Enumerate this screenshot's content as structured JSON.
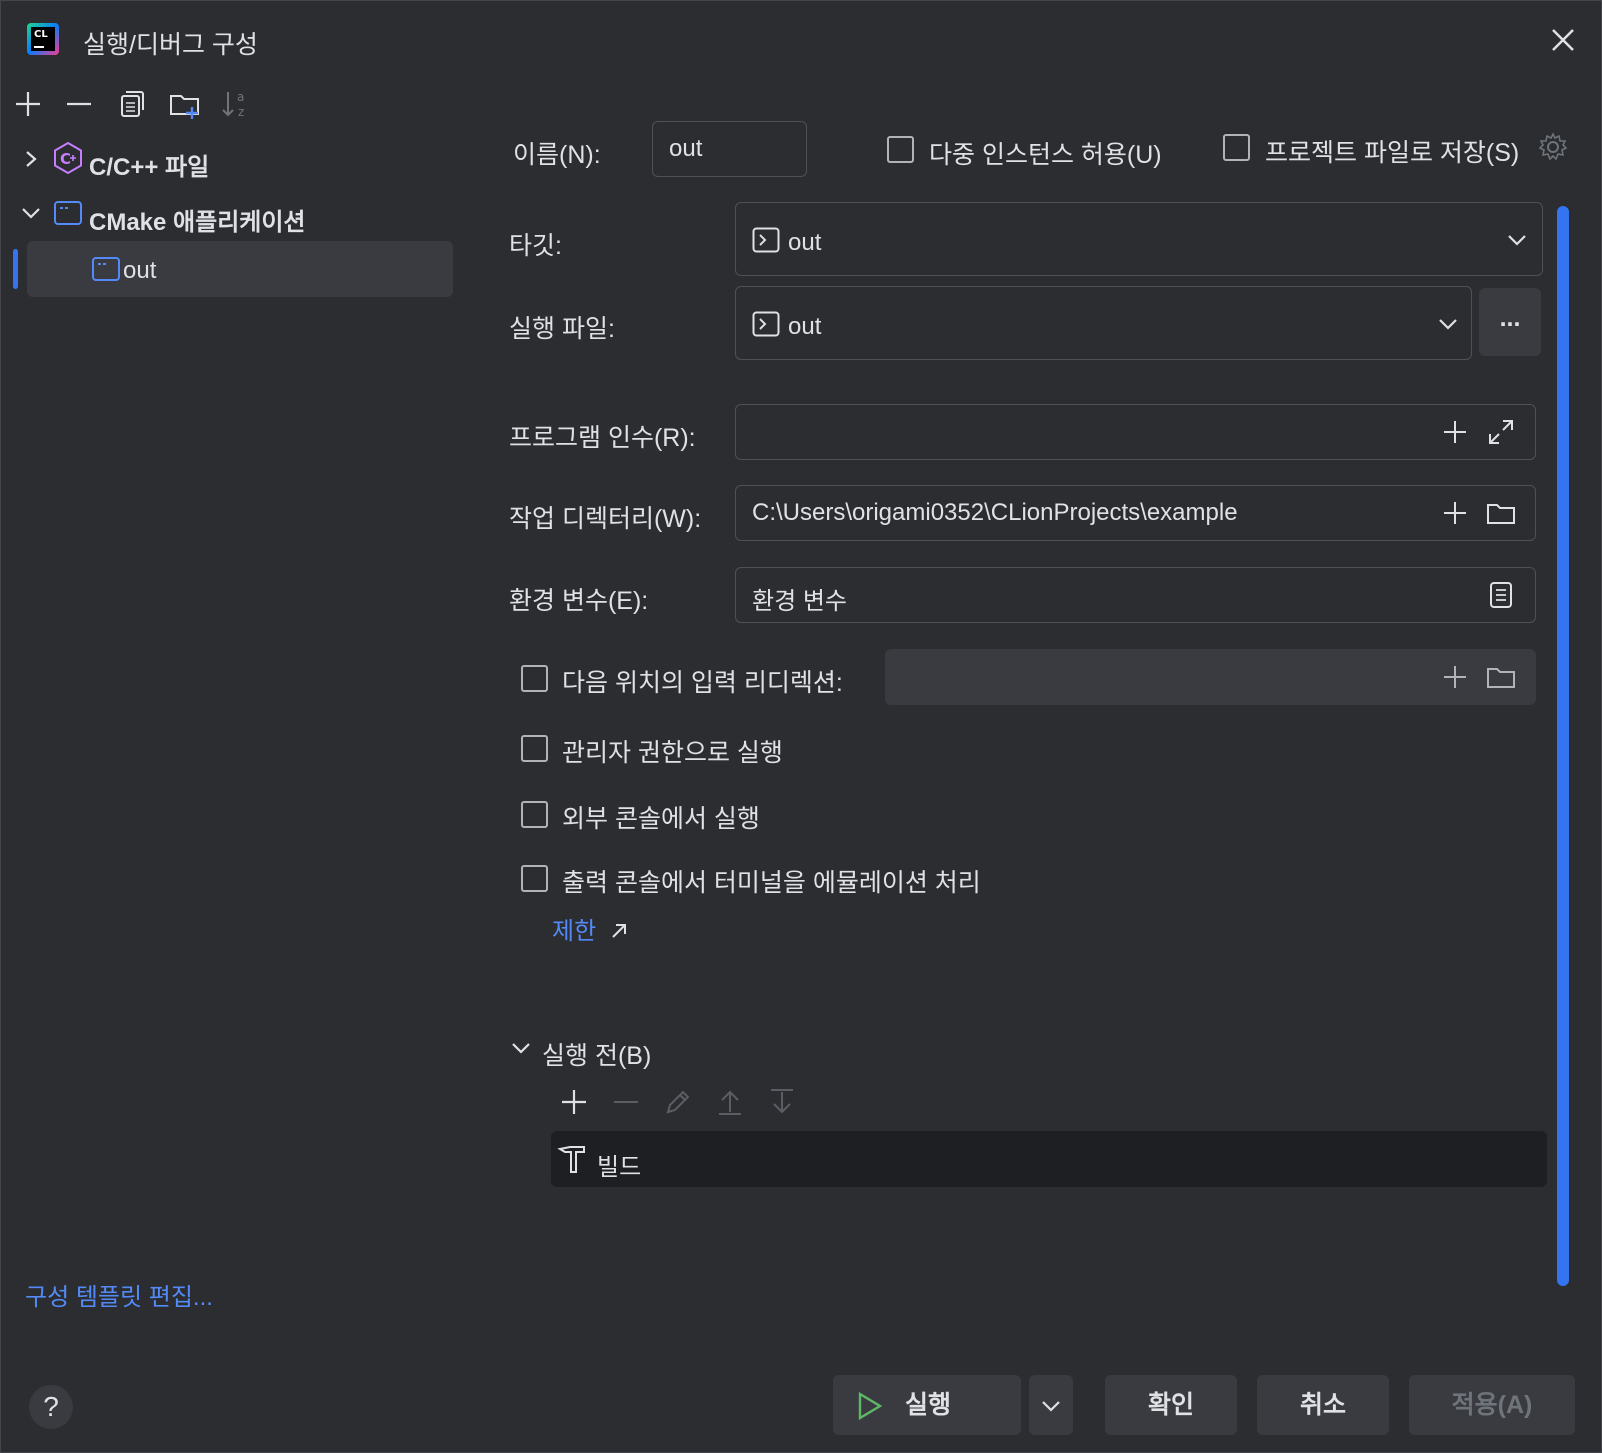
{
  "window": {
    "title": "실행/디버그 구성"
  },
  "left_toolbar": {
    "add": "add-icon",
    "remove": "remove-icon",
    "copy": "copy-icon",
    "folder": "new-folder-icon",
    "sort": "sort-icon"
  },
  "tree": {
    "group1": {
      "label": "C/C++ 파일"
    },
    "group2": {
      "label": "CMake 애플리케이션"
    },
    "item": {
      "label": "out"
    }
  },
  "edit_templates": "구성 템플릿 편집...",
  "form": {
    "name_label": "이름(N):",
    "name_value": "out",
    "multi_instance": "다중 인스턴스 허용(U)",
    "save_project": "프로젝트 파일로 저장(S)",
    "target_label": "타깃:",
    "target_value": "out",
    "exe_label": "실행 파일:",
    "exe_value": "out",
    "exe_browse": "...",
    "args_label": "프로그램 인수(R):",
    "args_value": "",
    "workdir_label": "작업 디렉터리(W):",
    "workdir_value": "C:\\Users\\origami0352\\CLionProjects\\example",
    "env_label": "환경 변수(E):",
    "env_value": "환경 변수",
    "redirect_label": "다음 위치의 입력 리디렉션:",
    "redirect_value": "",
    "admin_label": "관리자 권한으로 실행",
    "external_console_label": "외부 콘솔에서 실행",
    "emulate_terminal_label": "출력 콘솔에서 터미널을 에뮬레이션 처리",
    "limit_link": "제한",
    "before_launch_label": "실행 전(B)",
    "build_task": "빌드"
  },
  "buttons": {
    "run": "실행",
    "ok": "확인",
    "cancel": "취소",
    "apply": "적용(A)",
    "help": "?"
  }
}
